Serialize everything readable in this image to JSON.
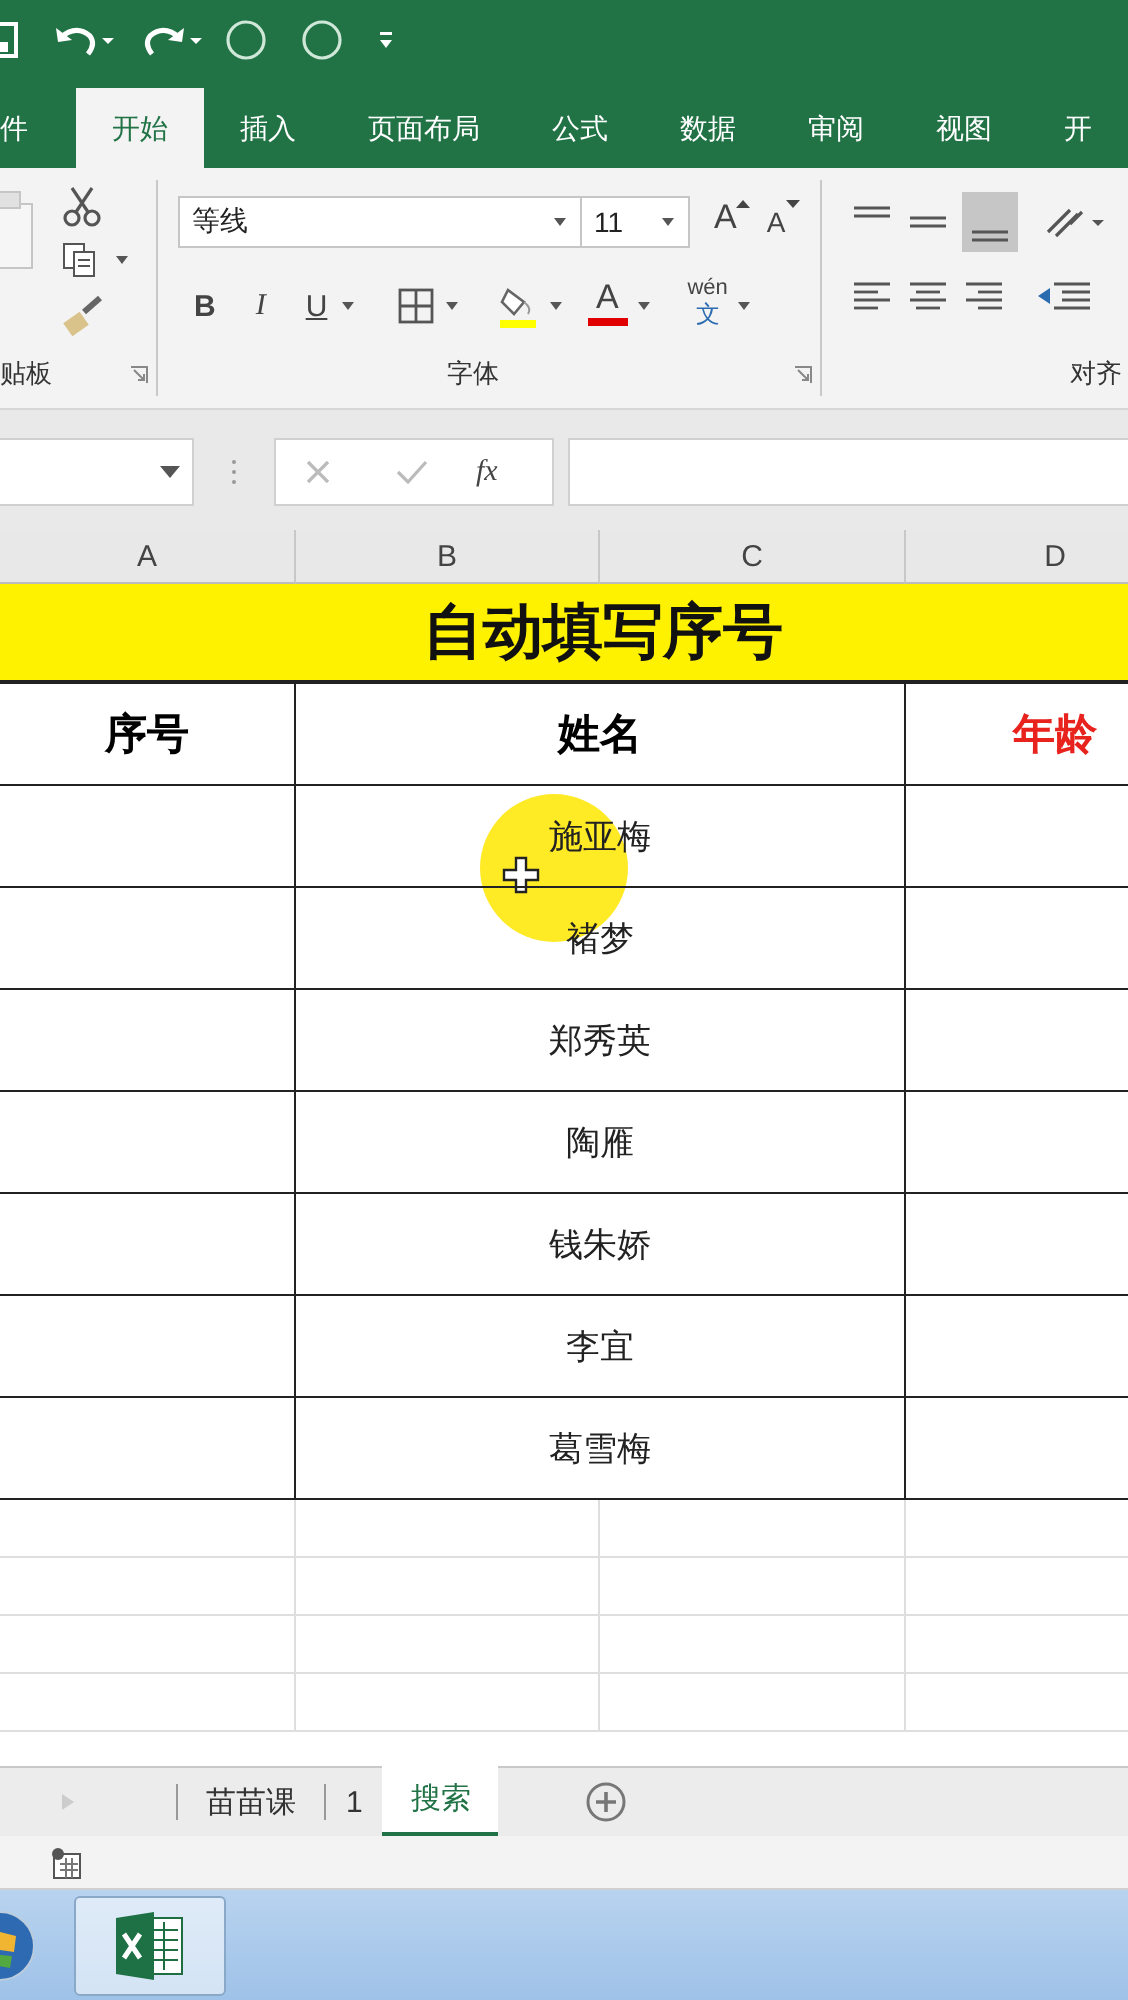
{
  "ribbon_tabs": [
    {
      "label": "件",
      "selected": false
    },
    {
      "label": "开始",
      "selected": true
    },
    {
      "label": "插入",
      "selected": false
    },
    {
      "label": "页面布局",
      "selected": false
    },
    {
      "label": "公式",
      "selected": false
    },
    {
      "label": "数据",
      "selected": false
    },
    {
      "label": "审阅",
      "selected": false
    },
    {
      "label": "视图",
      "selected": false
    },
    {
      "label": "开",
      "selected": false
    }
  ],
  "ribbon": {
    "clipboard_label": "贴板",
    "font_label": "字体",
    "alignment_label": "对齐",
    "font_name": "等线",
    "font_size": "11",
    "grow_font": "A",
    "shrink_font": "A",
    "bold": "B",
    "italic": "I",
    "underline": "U",
    "font_color": "A",
    "phonetic_top": "wén",
    "phonetic_bottom": "文"
  },
  "formula_bar": {
    "function_label": "fx"
  },
  "column_headers": [
    "A",
    "B",
    "C",
    "D"
  ],
  "sheet": {
    "title": "自动填写序号",
    "headers": [
      {
        "text": "序号",
        "color": "#000000"
      },
      {
        "text": "姓名",
        "color": "#000000"
      },
      {
        "text": "年龄",
        "color": "#e8231e"
      }
    ],
    "names": [
      "施亚梅",
      "褚梦",
      "郑秀英",
      "陶雁",
      "钱朱娇",
      "李宜",
      "葛雪梅"
    ]
  },
  "sheet_tabs": [
    {
      "label": "苗苗课",
      "selected": false
    },
    {
      "label": "1",
      "selected": false
    },
    {
      "label": "搜索",
      "selected": true
    }
  ]
}
